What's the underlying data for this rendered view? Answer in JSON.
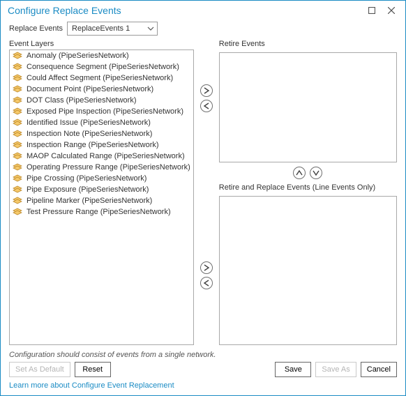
{
  "window": {
    "title": "Configure Replace Events"
  },
  "labels": {
    "replace_events": "Replace Events",
    "event_layers": "Event Layers",
    "retire_events": "Retire Events",
    "retire_replace": "Retire and Replace Events (Line Events Only)"
  },
  "dropdown": {
    "selected": "ReplaceEvents 1"
  },
  "layers": [
    "Anomaly (PipeSeriesNetwork)",
    "Consequence Segment (PipeSeriesNetwork)",
    "Could Affect Segment (PipeSeriesNetwork)",
    "Document Point (PipeSeriesNetwork)",
    "DOT Class (PipeSeriesNetwork)",
    "Exposed Pipe Inspection (PipeSeriesNetwork)",
    "Identified Issue (PipeSeriesNetwork)",
    "Inspection Note (PipeSeriesNetwork)",
    "Inspection Range (PipeSeriesNetwork)",
    "MAOP Calculated Range (PipeSeriesNetwork)",
    "Operating Pressure Range (PipeSeriesNetwork)",
    "Pipe Crossing (PipeSeriesNetwork)",
    "Pipe Exposure (PipeSeriesNetwork)",
    "Pipeline Marker (PipeSeriesNetwork)",
    "Test Pressure Range (PipeSeriesNetwork)"
  ],
  "hint": "Configuration should consist of events from a single network.",
  "buttons": {
    "set_default": "Set As Default",
    "reset": "Reset",
    "save": "Save",
    "save_as": "Save As",
    "cancel": "Cancel"
  },
  "link": "Learn more about Configure Event Replacement"
}
